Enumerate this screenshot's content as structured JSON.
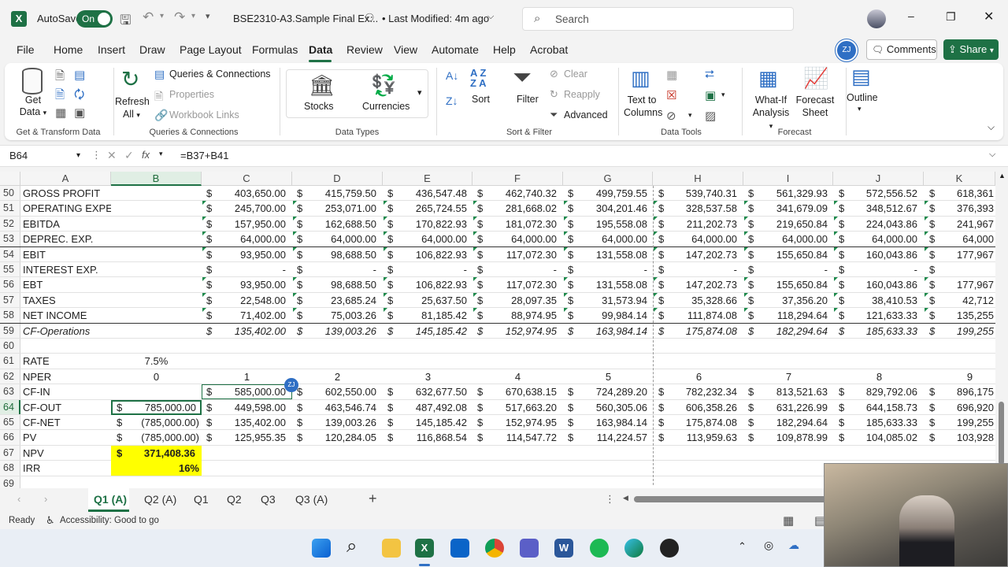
{
  "titlebar": {
    "autosave": "AutoSave",
    "toggle": "On",
    "filename": "BSE2310-A3.Sample Final Ex...",
    "modified": "• Last Modified: 4m ago",
    "search": "Search"
  },
  "tabs": [
    "File",
    "Home",
    "Insert",
    "Draw",
    "Page Layout",
    "Formulas",
    "Data",
    "Review",
    "View",
    "Automate",
    "Help",
    "Acrobat"
  ],
  "actions": {
    "user": "ZJ",
    "comments": "Comments",
    "share": "Share"
  },
  "ribbon": {
    "get_data": "Get Data",
    "get_transform": "Get & Transform Data",
    "refresh_all": "Refresh All",
    "queries": "Queries & Connections",
    "properties": "Properties",
    "workbook_links": "Workbook Links",
    "queries_group": "Queries & Connections",
    "stocks": "Stocks",
    "currencies": "Currencies",
    "data_types": "Data Types",
    "sort": "Sort",
    "filter": "Filter",
    "clear": "Clear",
    "reapply": "Reapply",
    "advanced": "Advanced",
    "sort_filter": "Sort & Filter",
    "text_to_columns": "Text to Columns",
    "data_tools": "Data Tools",
    "what_if": "What-If Analysis",
    "forecast_sheet": "Forecast Sheet",
    "forecast": "Forecast",
    "outline": "Outline"
  },
  "formula_bar": {
    "name_box": "B64",
    "formula": "=B37+B41"
  },
  "columns": [
    "A",
    "B",
    "C",
    "D",
    "E",
    "F",
    "G",
    "H",
    "I",
    "J",
    "K"
  ],
  "rows": [
    {
      "n": "50",
      "label": "GROSS PROFIT",
      "vals": [
        "403,650.00",
        "415,759.50",
        "436,547.48",
        "462,740.32",
        "499,759.55",
        "539,740.31",
        "561,329.93",
        "572,556.52",
        "618,361"
      ]
    },
    {
      "n": "51",
      "label": "OPERATING EXPENSES",
      "vals": [
        "245,700.00",
        "253,071.00",
        "265,724.55",
        "281,668.02",
        "304,201.46",
        "328,537.58",
        "341,679.09",
        "348,512.67",
        "376,393"
      ]
    },
    {
      "n": "52",
      "label": "EBITDA",
      "vals": [
        "157,950.00",
        "162,688.50",
        "170,822.93",
        "181,072.30",
        "195,558.08",
        "211,202.73",
        "219,650.84",
        "224,043.86",
        "241,967"
      ]
    },
    {
      "n": "53",
      "label": "DEPREC. EXP.",
      "vals": [
        "64,000.00",
        "64,000.00",
        "64,000.00",
        "64,000.00",
        "64,000.00",
        "64,000.00",
        "64,000.00",
        "64,000.00",
        "64,000"
      ]
    },
    {
      "n": "54",
      "label": "EBIT",
      "vals": [
        "93,950.00",
        "98,688.50",
        "106,822.93",
        "117,072.30",
        "131,558.08",
        "147,202.73",
        "155,650.84",
        "160,043.86",
        "177,967"
      ]
    },
    {
      "n": "55",
      "label": "INTEREST EXP.",
      "vals": [
        "-",
        "-",
        "-",
        "-",
        "-",
        "-",
        "-",
        "-",
        ""
      ]
    },
    {
      "n": "56",
      "label": "EBT",
      "vals": [
        "93,950.00",
        "98,688.50",
        "106,822.93",
        "117,072.30",
        "131,558.08",
        "147,202.73",
        "155,650.84",
        "160,043.86",
        "177,967"
      ]
    },
    {
      "n": "57",
      "label": "TAXES",
      "vals": [
        "22,548.00",
        "23,685.24",
        "25,637.50",
        "28,097.35",
        "31,573.94",
        "35,328.66",
        "37,356.20",
        "38,410.53",
        "42,712"
      ]
    },
    {
      "n": "58",
      "label": "NET INCOME",
      "vals": [
        "71,402.00",
        "75,003.26",
        "81,185.42",
        "88,974.95",
        "99,984.14",
        "111,874.08",
        "118,294.64",
        "121,633.33",
        "135,255"
      ]
    },
    {
      "n": "59",
      "label": "CF-Operations",
      "vals": [
        "135,402.00",
        "139,003.26",
        "145,185.42",
        "152,974.95",
        "163,984.14",
        "175,874.08",
        "182,294.64",
        "185,633.33",
        "199,255"
      ]
    }
  ],
  "rate": {
    "n": "61",
    "label": "RATE",
    "value": "7.5%"
  },
  "nper": {
    "n": "62",
    "label": "NPER",
    "b": "0",
    "periods": [
      "1",
      "2",
      "3",
      "4",
      "5",
      "6",
      "7",
      "8",
      "9"
    ]
  },
  "cf_in": {
    "n": "63",
    "label": "CF-IN",
    "vals": [
      "585,000.00",
      "602,550.00",
      "632,677.50",
      "670,638.15",
      "724,289.20",
      "782,232.34",
      "813,521.63",
      "829,792.06",
      "896,175"
    ]
  },
  "cf_out": {
    "n": "64",
    "label": "CF-OUT",
    "b": "785,000.00",
    "vals": [
      "449,598.00",
      "463,546.74",
      "487,492.08",
      "517,663.20",
      "560,305.06",
      "606,358.26",
      "631,226.99",
      "644,158.73",
      "696,920"
    ]
  },
  "cf_net": {
    "n": "65",
    "label": "CF-NET",
    "b": "(785,000.00)",
    "vals": [
      "135,402.00",
      "139,003.26",
      "145,185.42",
      "152,974.95",
      "163,984.14",
      "175,874.08",
      "182,294.64",
      "185,633.33",
      "199,255"
    ]
  },
  "pv": {
    "n": "66",
    "label": "PV",
    "b": "(785,000.00)",
    "vals": [
      "125,955.35",
      "120,284.05",
      "116,868.54",
      "114,547.72",
      "114,224.57",
      "113,959.63",
      "109,878.99",
      "104,085.02",
      "103,928"
    ]
  },
  "npv": {
    "n": "67",
    "label": "NPV",
    "value": "371,408.36"
  },
  "irr": {
    "n": "68",
    "label": "IRR",
    "value": "16%"
  },
  "empty_rows": [
    "60",
    "69"
  ],
  "currency": "$",
  "sheets": [
    "Q1 (A)",
    "Q2 (A)",
    "Q1",
    "Q2",
    "Q3",
    "Q3 (A)"
  ],
  "status": {
    "ready": "Ready",
    "accessibility": "Accessibility: Good to go"
  },
  "colors": {
    "excel_green": "#1e7145",
    "highlight": "#ffff00"
  }
}
